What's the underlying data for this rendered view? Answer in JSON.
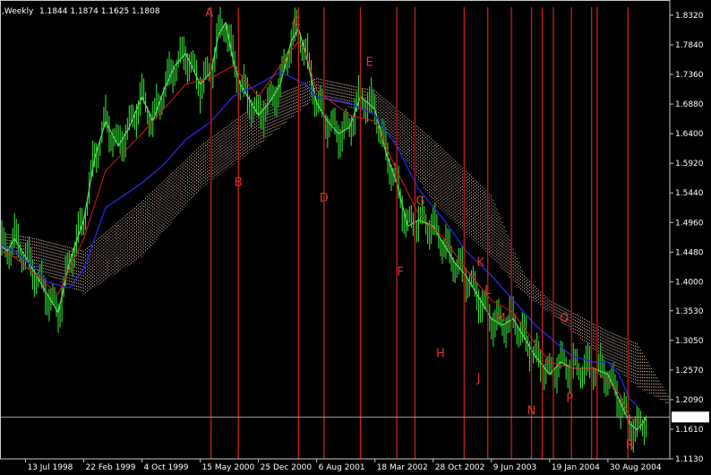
{
  "header": {
    "symbol_timeframe": ",Weekly",
    "ohlc": "1.1844 1.1874 1.1625 1.1808"
  },
  "colors": {
    "background": "#000000",
    "frame": "#c8c8c8",
    "price_bars": "#33d933",
    "close_line": "#58e058",
    "kijun_line": "#2626d9",
    "tenkan_line": "#e01a1a",
    "cloud": "#ffd6cc",
    "cycle_lines": "#c81e1e",
    "wave_labels": "#e0342a",
    "axis_text": "#ffffff",
    "last_price_line": "#b4b4b4"
  },
  "chart_data": {
    "type": "line",
    "title": "",
    "xlabel": "",
    "ylabel": "",
    "ylim": [
      1.113,
      1.845
    ],
    "x_range": [
      "1998-04-06",
      "2005-04-25"
    ],
    "grid": false,
    "y_ticks": [
      "1.8320",
      "1.7840",
      "1.7360",
      "1.6880",
      "1.6400",
      "1.5920",
      "1.5440",
      "1.4960",
      "1.4480",
      "1.4000",
      "1.3530",
      "1.3050",
      "1.2570",
      "1.2090",
      "1.1610",
      "1.1130"
    ],
    "x_ticks": [
      {
        "date": "1998-07-13",
        "label": "13 Jul 1998"
      },
      {
        "date": "1999-02-22",
        "label": "22 Feb 1999"
      },
      {
        "date": "1999-10-04",
        "label": "4 Oct 1999"
      },
      {
        "date": "2000-05-15",
        "label": "15 May 2000"
      },
      {
        "date": "2000-12-25",
        "label": "25 Dec 2000"
      },
      {
        "date": "2001-08-06",
        "label": "6 Aug 2001"
      },
      {
        "date": "2002-03-18",
        "label": "18 Mar 2002"
      },
      {
        "date": "2002-10-28",
        "label": "28 Oct 2002"
      },
      {
        "date": "2003-06-09",
        "label": "9 Jun 2003"
      },
      {
        "date": "2004-01-19",
        "label": "19 Jan 2004"
      },
      {
        "date": "2004-08-30",
        "label": "30 Aug 2004"
      }
    ],
    "last_price": {
      "value": 1.1808,
      "label": "1.1808"
    },
    "series": [
      {
        "type": "close",
        "points": [
          [
            "1998-04-06",
            1.46
          ],
          [
            "1998-05-04",
            1.45
          ],
          [
            "1998-06-01",
            1.47
          ],
          [
            "1998-07-13",
            1.44
          ],
          [
            "1998-08-24",
            1.41
          ],
          [
            "1998-10-05",
            1.38
          ],
          [
            "1998-11-16",
            1.35
          ],
          [
            "1998-12-28",
            1.43
          ],
          [
            "1999-02-22",
            1.5
          ],
          [
            "1999-04-05",
            1.6
          ],
          [
            "1999-05-17",
            1.66
          ],
          [
            "1999-07-05",
            1.62
          ],
          [
            "1999-08-16",
            1.65
          ],
          [
            "1999-10-04",
            1.7
          ],
          [
            "1999-11-15",
            1.66
          ],
          [
            "1999-12-27",
            1.71
          ],
          [
            "2000-02-07",
            1.75
          ],
          [
            "2000-03-20",
            1.77
          ],
          [
            "2000-05-15",
            1.72
          ],
          [
            "2000-06-26",
            1.74
          ],
          [
            "2000-07-24",
            1.8
          ],
          [
            "2000-08-21",
            1.82
          ],
          [
            "2000-09-18",
            1.76
          ],
          [
            "2000-10-16",
            1.72
          ],
          [
            "2000-11-13",
            1.7
          ],
          [
            "2000-12-25",
            1.67
          ],
          [
            "2001-02-05",
            1.69
          ],
          [
            "2001-03-19",
            1.72
          ],
          [
            "2001-04-30",
            1.79
          ],
          [
            "2001-05-28",
            1.81
          ],
          [
            "2001-06-25",
            1.77
          ],
          [
            "2001-08-06",
            1.69
          ],
          [
            "2001-09-17",
            1.66
          ],
          [
            "2001-10-29",
            1.64
          ],
          [
            "2001-12-10",
            1.65
          ],
          [
            "2002-01-21",
            1.7
          ],
          [
            "2002-03-18",
            1.68
          ],
          [
            "2002-04-29",
            1.61
          ],
          [
            "2002-06-10",
            1.56
          ],
          [
            "2002-07-22",
            1.49
          ],
          [
            "2002-09-02",
            1.5
          ],
          [
            "2002-10-28",
            1.49
          ],
          [
            "2002-12-09",
            1.46
          ],
          [
            "2003-01-20",
            1.43
          ],
          [
            "2003-03-03",
            1.41
          ],
          [
            "2003-04-14",
            1.38
          ],
          [
            "2003-06-09",
            1.34
          ],
          [
            "2003-07-21",
            1.33
          ],
          [
            "2003-09-01",
            1.34
          ],
          [
            "2003-10-13",
            1.31
          ],
          [
            "2003-11-24",
            1.28
          ],
          [
            "2004-01-19",
            1.25
          ],
          [
            "2004-03-01",
            1.27
          ],
          [
            "2004-04-12",
            1.26
          ],
          [
            "2004-05-24",
            1.26
          ],
          [
            "2004-07-05",
            1.26
          ],
          [
            "2004-08-30",
            1.25
          ],
          [
            "2004-10-11",
            1.21
          ],
          [
            "2004-11-22",
            1.17
          ],
          [
            "2004-12-20",
            1.16
          ],
          [
            "2005-01-10",
            1.17
          ],
          [
            "2005-01-24",
            1.18
          ]
        ]
      },
      {
        "type": "kijun",
        "points": [
          [
            "1998-04-06",
            1.46
          ],
          [
            "1998-06-01",
            1.45
          ],
          [
            "1998-08-24",
            1.42
          ],
          [
            "1998-10-05",
            1.4
          ],
          [
            "1998-12-28",
            1.39
          ],
          [
            "1999-02-22",
            1.42
          ],
          [
            "1999-05-17",
            1.52
          ],
          [
            "1999-10-04",
            1.56
          ],
          [
            "1999-12-27",
            1.59
          ],
          [
            "2000-03-20",
            1.63
          ],
          [
            "2000-06-26",
            1.66
          ],
          [
            "2000-09-18",
            1.7
          ],
          [
            "2000-12-25",
            1.72
          ],
          [
            "2001-03-19",
            1.74
          ],
          [
            "2001-06-25",
            1.72
          ],
          [
            "2001-08-06",
            1.7
          ],
          [
            "2001-12-10",
            1.69
          ],
          [
            "2002-03-18",
            1.67
          ],
          [
            "2002-06-10",
            1.62
          ],
          [
            "2002-09-02",
            1.55
          ],
          [
            "2002-12-09",
            1.5
          ],
          [
            "2003-03-03",
            1.45
          ],
          [
            "2003-06-09",
            1.41
          ],
          [
            "2003-09-01",
            1.37
          ],
          [
            "2003-11-24",
            1.33
          ],
          [
            "2004-01-19",
            1.31
          ],
          [
            "2004-04-12",
            1.28
          ],
          [
            "2004-07-05",
            1.27
          ],
          [
            "2004-08-30",
            1.27
          ],
          [
            "2004-10-11",
            1.25
          ],
          [
            "2004-11-22",
            1.21
          ],
          [
            "2004-12-20",
            1.2
          ]
        ]
      },
      {
        "type": "tenkan",
        "points": [
          [
            "1998-04-06",
            1.45
          ],
          [
            "1998-06-01",
            1.44
          ],
          [
            "1998-08-24",
            1.41
          ],
          [
            "1998-11-16",
            1.38
          ],
          [
            "1999-02-22",
            1.47
          ],
          [
            "1999-05-17",
            1.58
          ],
          [
            "1999-10-04",
            1.64
          ],
          [
            "1999-12-27",
            1.68
          ],
          [
            "2000-03-20",
            1.72
          ],
          [
            "2000-06-26",
            1.73
          ],
          [
            "2000-09-18",
            1.75
          ],
          [
            "2000-12-25",
            1.7
          ],
          [
            "2001-03-19",
            1.75
          ],
          [
            "2001-05-28",
            1.79
          ],
          [
            "2001-06-25",
            1.77
          ],
          [
            "2001-08-06",
            1.71
          ],
          [
            "2001-12-10",
            1.67
          ],
          [
            "2002-03-18",
            1.66
          ],
          [
            "2002-06-10",
            1.58
          ],
          [
            "2002-09-02",
            1.51
          ],
          [
            "2002-12-09",
            1.47
          ],
          [
            "2003-03-03",
            1.42
          ],
          [
            "2003-06-09",
            1.37
          ],
          [
            "2003-09-01",
            1.35
          ],
          [
            "2003-11-24",
            1.3
          ],
          [
            "2004-01-19",
            1.27
          ],
          [
            "2004-04-12",
            1.26
          ],
          [
            "2004-07-05",
            1.26
          ],
          [
            "2004-10-11",
            1.22
          ],
          [
            "2004-11-22",
            1.18
          ],
          [
            "2005-01-10",
            1.17
          ]
        ]
      },
      {
        "type": "cloud",
        "upper": [
          [
            "1998-04-06",
            1.48
          ],
          [
            "1998-08-24",
            1.47
          ],
          [
            "1999-02-22",
            1.45
          ],
          [
            "1999-10-04",
            1.53
          ],
          [
            "2000-05-15",
            1.62
          ],
          [
            "2000-12-25",
            1.69
          ],
          [
            "2001-08-06",
            1.73
          ],
          [
            "2002-03-18",
            1.71
          ],
          [
            "2002-10-28",
            1.63
          ],
          [
            "2003-06-09",
            1.54
          ],
          [
            "2003-10-13",
            1.41
          ],
          [
            "2004-01-19",
            1.37
          ],
          [
            "2004-08-30",
            1.32
          ],
          [
            "2004-12-20",
            1.3
          ],
          [
            "2005-04-25",
            1.21
          ]
        ],
        "lower": [
          [
            "1998-04-06",
            1.45
          ],
          [
            "1998-08-24",
            1.42
          ],
          [
            "1999-02-22",
            1.38
          ],
          [
            "1999-10-04",
            1.44
          ],
          [
            "2000-05-15",
            1.55
          ],
          [
            "2000-12-25",
            1.62
          ],
          [
            "2001-08-06",
            1.7
          ],
          [
            "2002-03-18",
            1.67
          ],
          [
            "2002-10-28",
            1.53
          ],
          [
            "2003-06-09",
            1.44
          ],
          [
            "2003-10-13",
            1.38
          ],
          [
            "2004-01-19",
            1.35
          ],
          [
            "2004-08-30",
            1.27
          ],
          [
            "2004-12-20",
            1.23
          ],
          [
            "2005-04-25",
            1.2
          ]
        ]
      }
    ],
    "cycle_lines": [
      "2000-06-26",
      "2000-10-09",
      "2001-05-28",
      "2001-09-03",
      "2002-01-21",
      "2002-06-10",
      "2002-08-19",
      "2003-02-24",
      "2003-05-26",
      "2003-08-25",
      "2003-11-10",
      "2003-12-22",
      "2004-02-02",
      "2004-04-12",
      "2004-06-28",
      "2004-07-19",
      "2004-11-15"
    ],
    "wave_labels": [
      {
        "label": "A",
        "date": "2000-06-19",
        "value": 1.83
      },
      {
        "label": "B",
        "date": "2000-10-09",
        "value": 1.555
      },
      {
        "label": "C",
        "date": "2001-05-21",
        "value": 1.815
      },
      {
        "label": "D",
        "date": "2001-09-03",
        "value": 1.53
      },
      {
        "label": "E",
        "date": "2002-02-25",
        "value": 1.75
      },
      {
        "label": "F",
        "date": "2002-06-24",
        "value": 1.41
      },
      {
        "label": "G",
        "date": "2002-09-09",
        "value": 1.525
      },
      {
        "label": "H",
        "date": "2002-11-25",
        "value": 1.278
      },
      {
        "label": "J",
        "date": "2003-04-21",
        "value": 1.238
      },
      {
        "label": "K",
        "date": "2003-04-28",
        "value": 1.425
      },
      {
        "label": "L",
        "date": "2003-05-26",
        "value": 1.38
      },
      {
        "label": "M",
        "date": "2003-07-14",
        "value": 1.335
      },
      {
        "label": "N",
        "date": "2003-11-10",
        "value": 1.185
      },
      {
        "label": "O",
        "date": "2004-03-15",
        "value": 1.335
      },
      {
        "label": "P",
        "date": "2004-04-05",
        "value": 1.205
      },
      {
        "label": "R",
        "date": "2004-11-22",
        "value": 1.13
      }
    ],
    "price_bars": {
      "amplitude_hint": 0.05
    }
  }
}
